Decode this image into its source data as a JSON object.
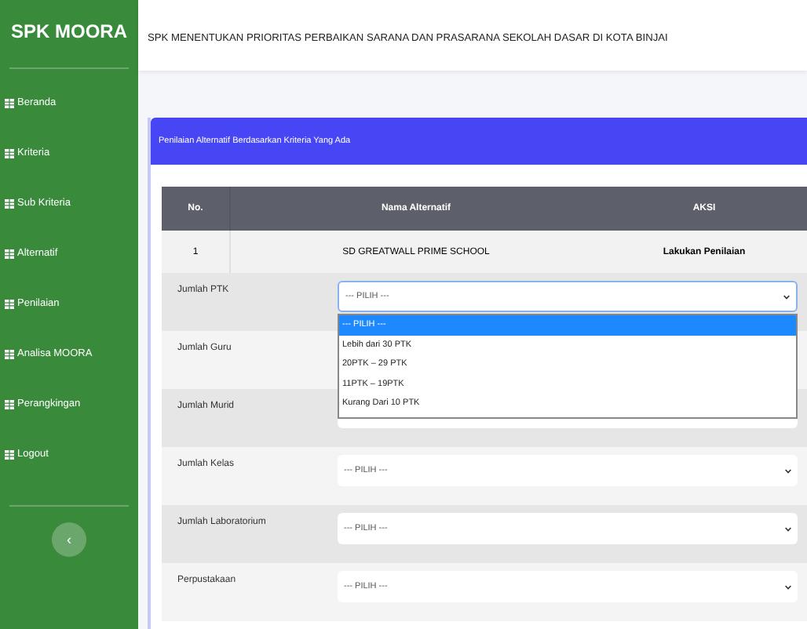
{
  "sidebar": {
    "brand": "SPK MOORA",
    "items": [
      {
        "label": "Beranda"
      },
      {
        "label": "Kriteria"
      },
      {
        "label": "Sub Kriteria"
      },
      {
        "label": "Alternatif"
      },
      {
        "label": "Penilaian"
      },
      {
        "label": "Analisa MOORA"
      },
      {
        "label": "Perangkingan"
      },
      {
        "label": "Logout"
      }
    ],
    "toggle": "‹"
  },
  "header": {
    "title": "SPK MENENTUKAN PRIORITAS PERBAIKAN SARANA DAN PRASARANA SEKOLAH DASAR DI KOTA BINJAI"
  },
  "card": {
    "title": "Penilaian Alternatif Berdasarkan Kriteria Yang Ada",
    "table": {
      "columns": [
        "No.",
        "Nama Alternatif",
        "AKSI"
      ],
      "rows": [
        [
          "1",
          "SD GREATWALL PRIME SCHOOL",
          "Lakukan Penilaian"
        ]
      ]
    },
    "fields": [
      {
        "label": "Jumlah PTK",
        "value": "--- PILIH ---",
        "expanded": true,
        "options": [
          {
            "label": "--- PILIH ---",
            "selected": true
          },
          {
            "label": "Lebih dari 30 PTK",
            "selected": false
          },
          {
            "label": "20PTK – 29 PTK",
            "selected": false
          },
          {
            "label": "11PTK – 19PTK",
            "selected": false
          },
          {
            "label": "Kurang Dari 10 PTK",
            "selected": false
          }
        ]
      },
      {
        "label": "Jumlah Guru",
        "expanded": false
      },
      {
        "label": "Jumlah Murid",
        "expanded": false
      },
      {
        "label": "Jumlah Kelas",
        "value": "--- PILIH ---",
        "expanded": false
      },
      {
        "label": "Jumlah Laboratorium",
        "value": "--- PILIH ---",
        "expanded": false
      },
      {
        "label": "Perpustakaan",
        "value": "--- PILIH ---",
        "expanded": false
      }
    ]
  }
}
